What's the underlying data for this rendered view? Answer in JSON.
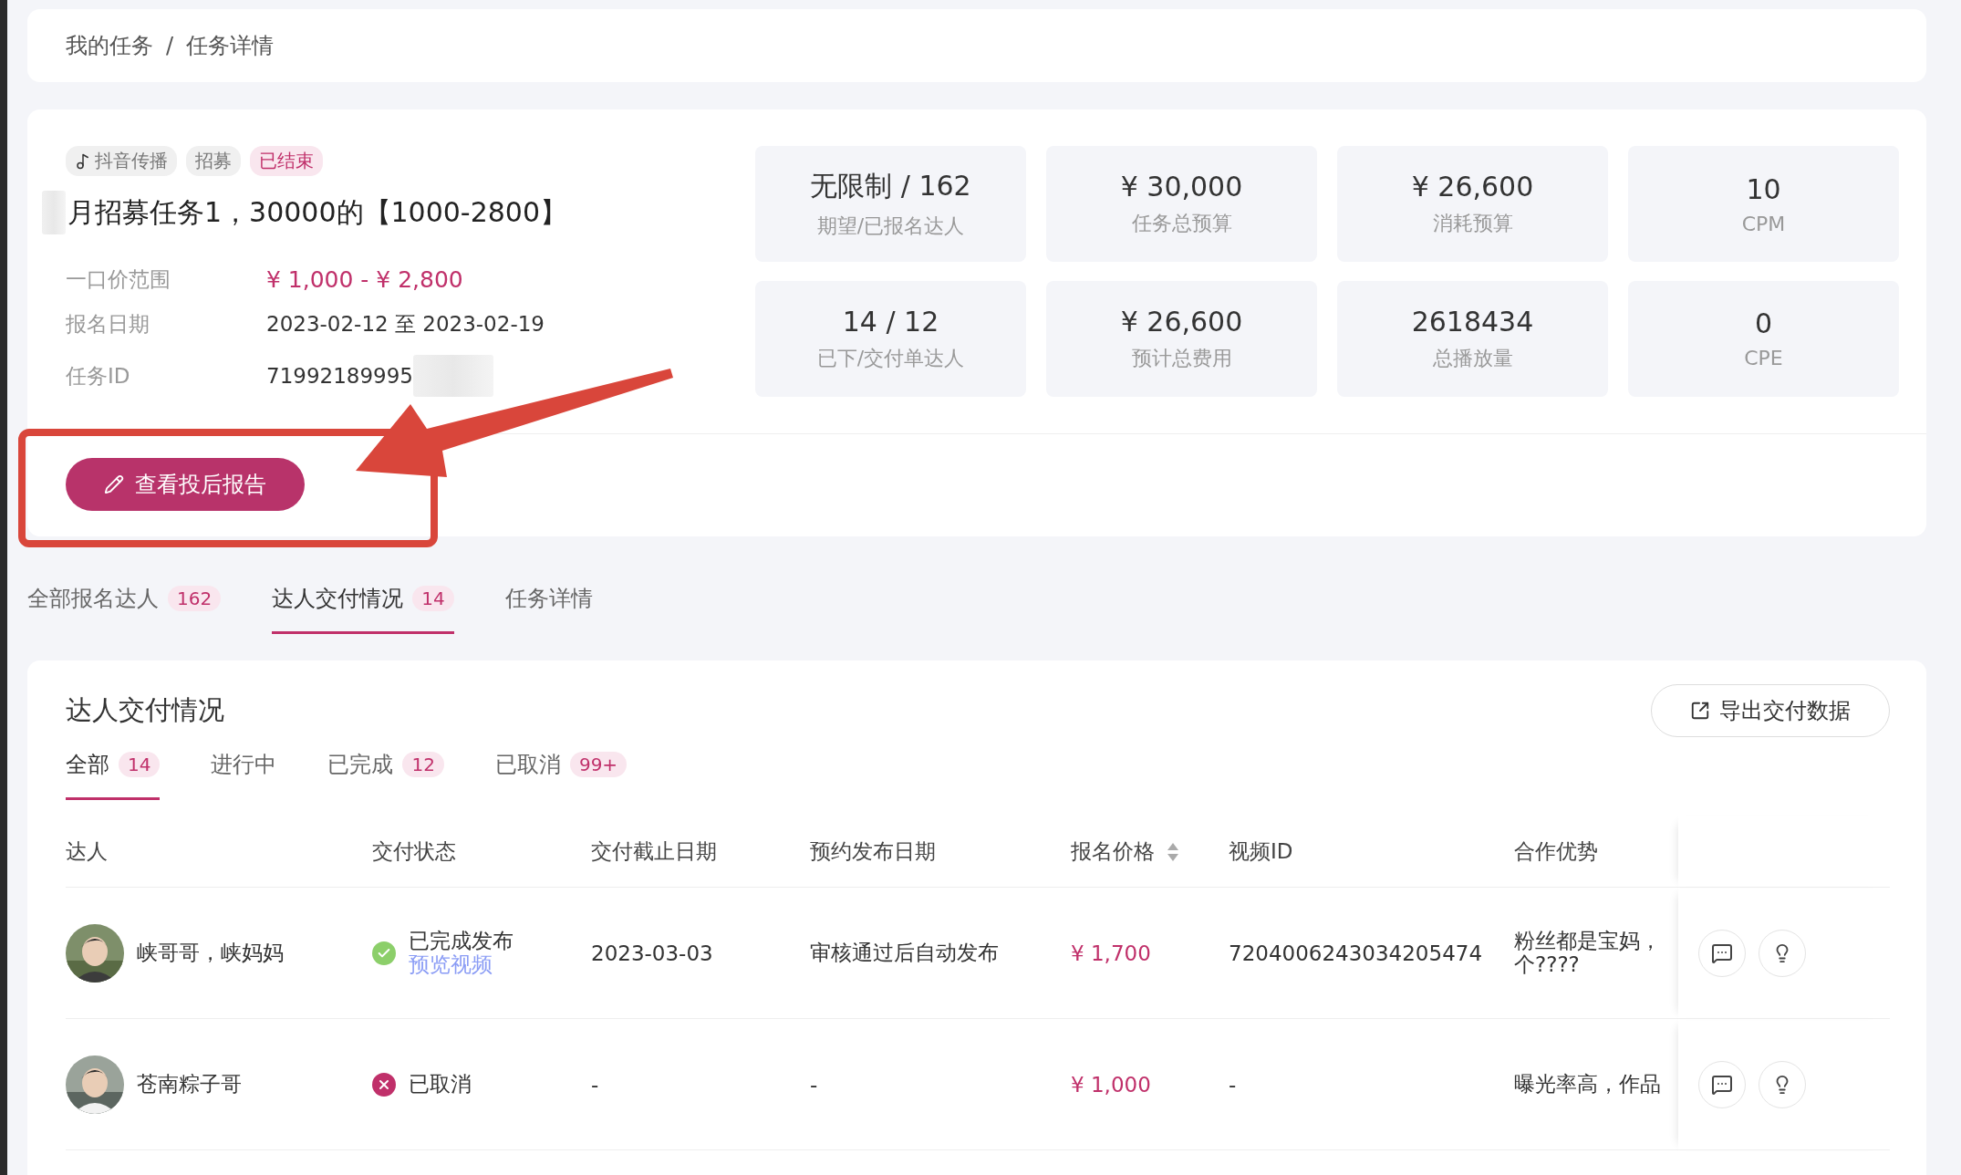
{
  "breadcrumb": {
    "items": [
      "我的任务",
      "任务详情"
    ],
    "separator": "/"
  },
  "task": {
    "tags": [
      {
        "label": "抖音传播",
        "kind": "platform"
      },
      {
        "label": "招募",
        "kind": "plain"
      },
      {
        "label": "已结束",
        "kind": "status"
      }
    ],
    "title": "月招募任务1，30000的【1000-2800】",
    "info": [
      {
        "label": "一口价范围",
        "value": "¥ 1,000 - ¥ 2,800",
        "kind": "price"
      },
      {
        "label": "报名日期",
        "value": "2023-02-12 至 2023-02-19",
        "kind": "text"
      },
      {
        "label": "任务ID",
        "value": "71992189995",
        "kind": "redacted"
      }
    ],
    "stats": [
      {
        "value": "无限制 / 162",
        "label": "期望/已报名达人"
      },
      {
        "value": "¥ 30,000",
        "label": "任务总预算"
      },
      {
        "value": "¥ 26,600",
        "label": "消耗预算"
      },
      {
        "value": "10",
        "label": "CPM"
      },
      {
        "value": "14 / 12",
        "label": "已下/交付单达人"
      },
      {
        "value": "¥ 26,600",
        "label": "预计总费用"
      },
      {
        "value": "2618434",
        "label": "总播放量"
      },
      {
        "value": "0",
        "label": "CPE"
      }
    ],
    "report_button": "查看投后报告"
  },
  "tabs": [
    {
      "label": "全部报名达人",
      "count": "162",
      "selected": false
    },
    {
      "label": "达人交付情况",
      "count": "14",
      "selected": true
    },
    {
      "label": "任务详情",
      "selected": false
    }
  ],
  "delivery": {
    "title": "达人交付情况",
    "export_button": "导出交付数据",
    "filters": [
      {
        "label": "全部",
        "count": "14",
        "selected": true
      },
      {
        "label": "进行中",
        "selected": false
      },
      {
        "label": "已完成",
        "count": "12",
        "selected": false
      },
      {
        "label": "已取消",
        "count": "99+",
        "selected": false
      }
    ],
    "columns": [
      {
        "label": "达人",
        "sortable": false
      },
      {
        "label": "交付状态",
        "sortable": false
      },
      {
        "label": "交付截止日期",
        "sortable": false
      },
      {
        "label": "预约发布日期",
        "sortable": false
      },
      {
        "label": "报名价格",
        "sortable": true
      },
      {
        "label": "视频ID",
        "sortable": false
      },
      {
        "label": "合作优势",
        "sortable": false
      }
    ],
    "rows": [
      {
        "name": "峡哥哥，峡妈妈",
        "status": {
          "kind": "done",
          "label": "已完成发布",
          "link": "预览视频"
        },
        "deadline": "2023-03-03",
        "publish": "审核通过后自动发布",
        "price": "¥ 1,700",
        "video_id": "7204006243034205474",
        "advantage": [
          "粉丝都是宝妈，",
          "个????"
        ]
      },
      {
        "name": "苍南粽子哥",
        "status": {
          "kind": "cancelled",
          "label": "已取消"
        },
        "deadline": "-",
        "publish": "-",
        "price": "¥ 1,000",
        "video_id": "-",
        "advantage": [
          "曝光率高，作品"
        ]
      }
    ]
  }
}
